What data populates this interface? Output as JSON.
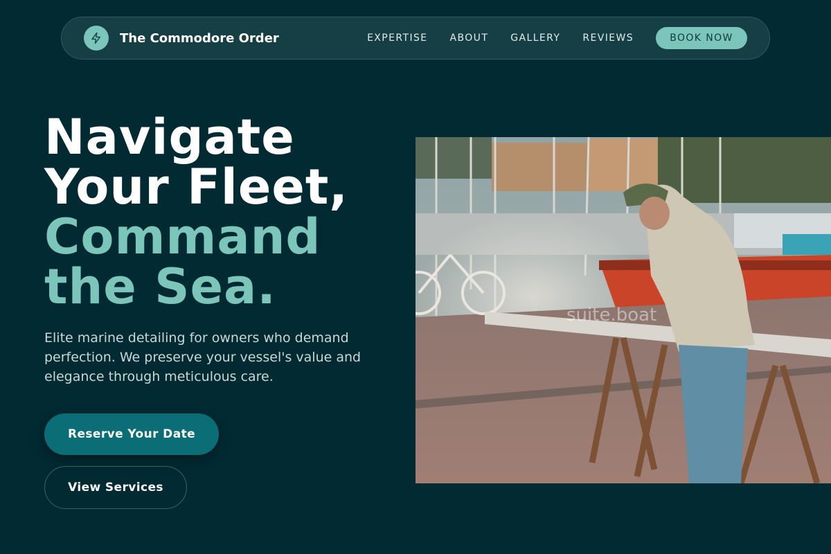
{
  "brand": {
    "name": "The Commodore Order",
    "icon": "lightning-icon"
  },
  "nav": {
    "links": [
      "EXPERTISE",
      "ABOUT",
      "GALLERY",
      "REVIEWS"
    ],
    "cta_label": "BOOK NOW"
  },
  "hero": {
    "title_line1": "Navigate",
    "title_line2": "Your Fleet,",
    "title_line3": "Command",
    "title_line4": "the Sea.",
    "description": "Elite marine detailing for owners who demand perfection. We preserve your vessel's value and elegance through meticulous care.",
    "primary_button": "Reserve Your Date",
    "secondary_button": "View Services",
    "image_watermark": "suite.boat"
  },
  "colors": {
    "background": "#022a32",
    "accent": "#7cc5bb",
    "primary_button": "#0b6e77"
  }
}
